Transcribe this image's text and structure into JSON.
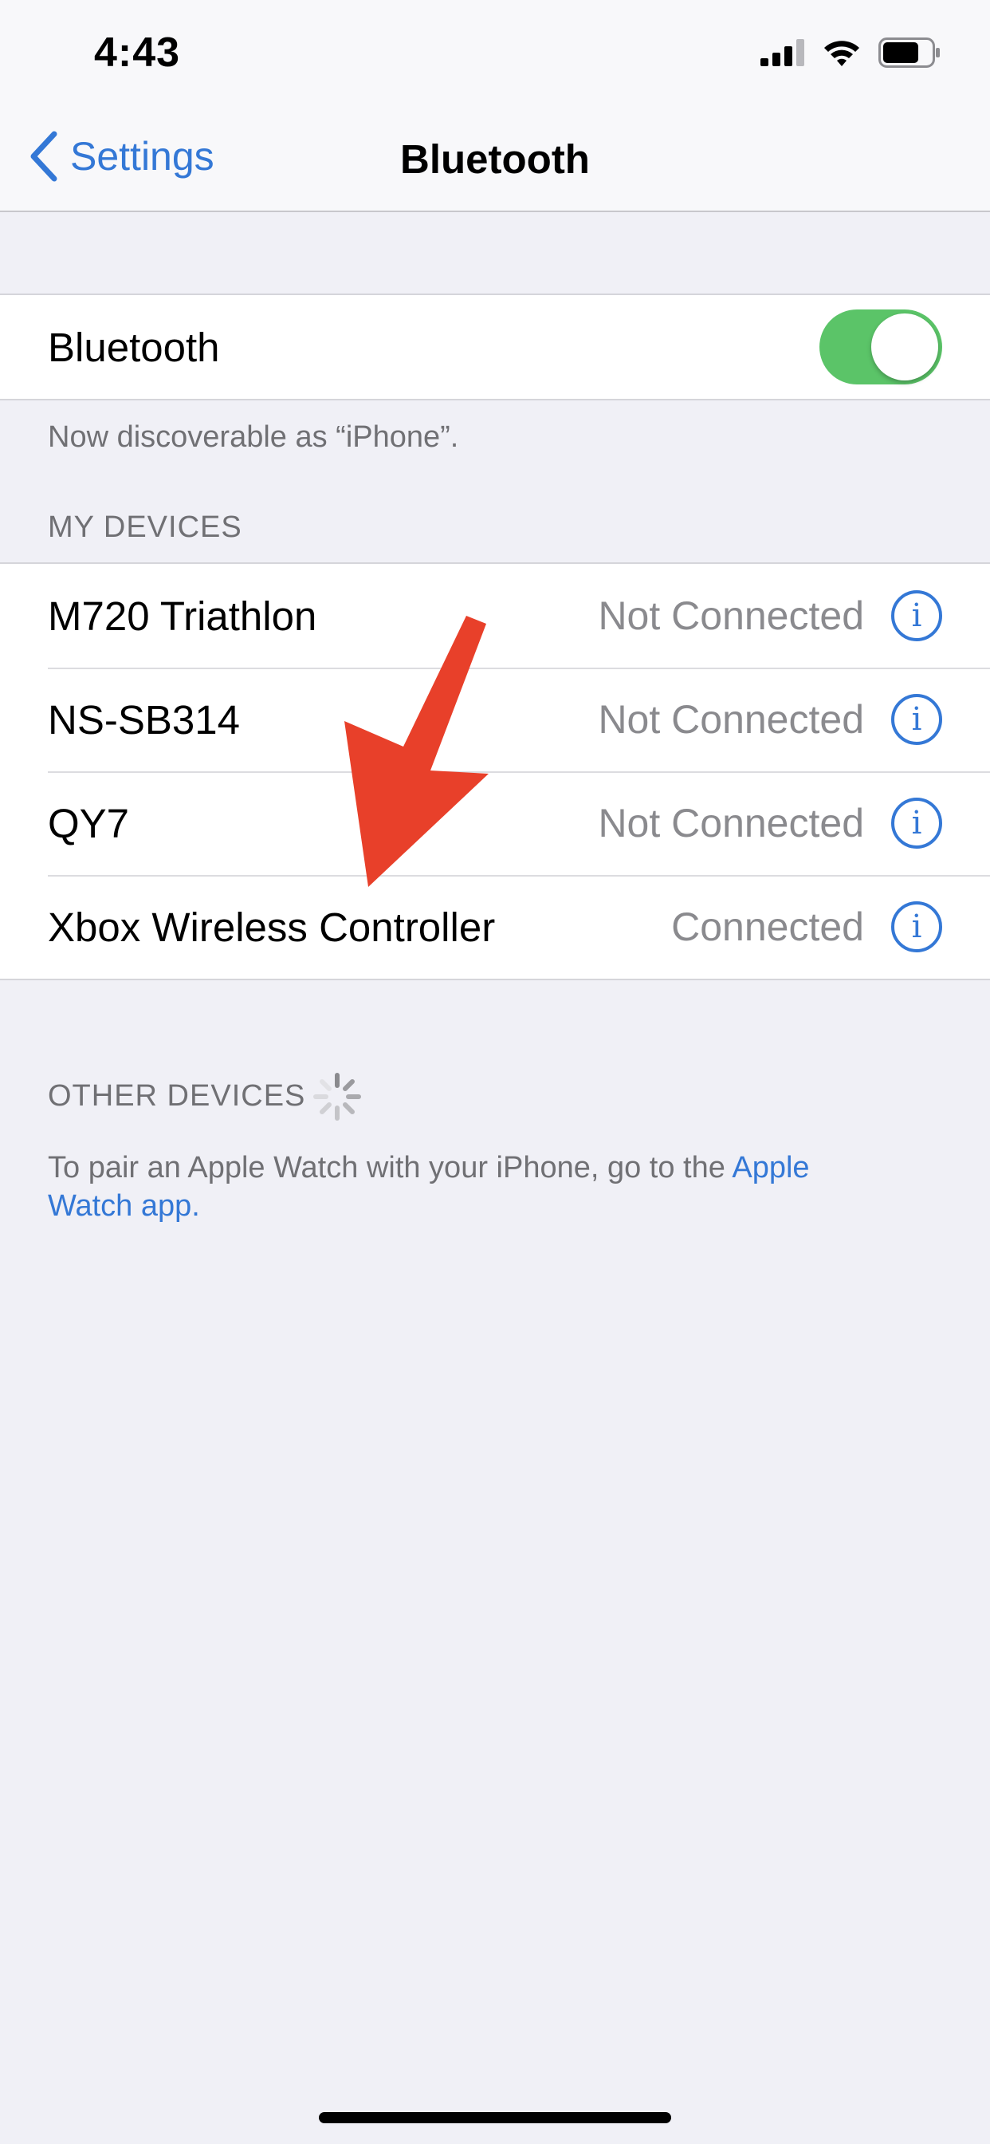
{
  "status_bar": {
    "time": "4:43"
  },
  "nav": {
    "back_label": "Settings",
    "title": "Bluetooth"
  },
  "bluetooth_toggle": {
    "label": "Bluetooth",
    "on": true
  },
  "discoverable_text": "Now discoverable as “iPhone”.",
  "my_devices": {
    "header": "MY DEVICES",
    "items": [
      {
        "name": "M720 Triathlon",
        "status": "Not Connected"
      },
      {
        "name": "NS-SB314",
        "status": "Not Connected"
      },
      {
        "name": "QY7",
        "status": "Not Connected"
      },
      {
        "name": "Xbox Wireless Controller",
        "status": "Connected"
      }
    ]
  },
  "other_devices": {
    "header": "OTHER DEVICES",
    "pair_text_prefix": "To pair an Apple Watch with your iPhone, go to the ",
    "pair_link_line1": "Apple",
    "pair_link_line2": "Watch app."
  },
  "icons": {
    "back": "chevron-left-icon",
    "info": "info-icon",
    "spinner": "activity-spinner-icon",
    "annotation": "red-arrow"
  },
  "colors": {
    "accent": "#3478d6",
    "toggle_on": "#5bc468",
    "annotation_arrow": "#e8402a",
    "background": "#f0f0f6"
  }
}
